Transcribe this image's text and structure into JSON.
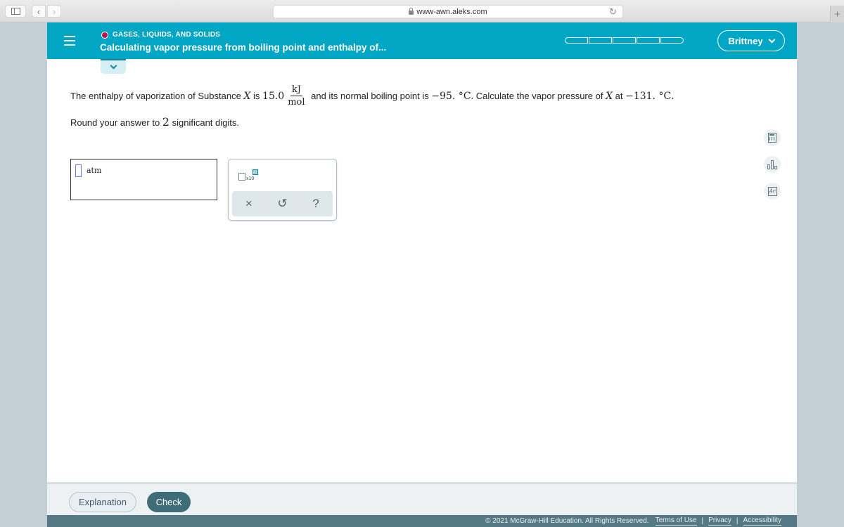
{
  "browser": {
    "url": "www-awn.aleks.com",
    "back_glyph": "‹",
    "forward_glyph": "›",
    "reload_glyph": "↻",
    "new_tab_glyph": "+"
  },
  "header": {
    "topic": "GASES, LIQUIDS, AND SOLIDS",
    "topic_dot_color": "#b5174e",
    "lesson_title": "Calculating vapor pressure from boiling point and enthalpy of...",
    "progress_segments": 5,
    "progress_filled": 0,
    "user_name": "Brittney",
    "accent_color": "#00a6c4"
  },
  "question": {
    "part1": "The enthalpy of vaporization of Substance ",
    "var": "X",
    "part2": " is ",
    "enthalpy_value": "15.0",
    "unit_num": "kJ",
    "unit_den": "mol",
    "part3": " and its normal boiling point is ",
    "boiling_point": "−95. °C",
    "part4": ". Calculate the vapor pressure of ",
    "part5": " at ",
    "target_temp": "−131. °C",
    "part6": ".",
    "round_prefix": "Round your answer to ",
    "sig_figs": "2",
    "round_suffix": " significant digits."
  },
  "answer": {
    "value": "",
    "unit": "atm"
  },
  "keypad": {
    "sci_notation_label": "x10",
    "clear_glyph": "×",
    "undo_glyph": "↺",
    "help_glyph": "?"
  },
  "tools": {
    "periodic_label": "Ar"
  },
  "actions": {
    "explanation": "Explanation",
    "check": "Check"
  },
  "footer": {
    "copyright": "© 2021 McGraw-Hill Education. All Rights Reserved.",
    "terms": "Terms of Use",
    "privacy": "Privacy",
    "accessibility": "Accessibility",
    "separator": "|"
  }
}
